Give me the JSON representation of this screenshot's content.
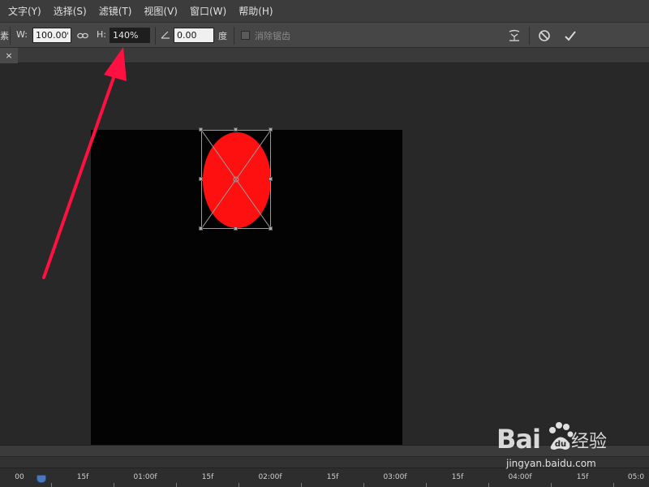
{
  "menu": {
    "items": [
      "文字(Y)",
      "选择(S)",
      "滤镜(T)",
      "视图(V)",
      "窗口(W)",
      "帮助(H)"
    ]
  },
  "options": {
    "left_fragment": "素",
    "width_label": "W:",
    "width_value": "100.00%",
    "link_icon": "chain-link-icon",
    "height_label": "H:",
    "height_value": "140%",
    "angle_icon": "angle-icon",
    "angle_value": "0.00",
    "angle_unit": "度",
    "antialias_label": "消除锯齿",
    "antialias_checked": false,
    "warp_icon": "warp-mode-icon",
    "cancel_icon": "cancel-icon",
    "commit_icon": "commit-checkmark-icon"
  },
  "tab": {
    "close_symbol": "×"
  },
  "artwork": {
    "shape_color": "#ff1010",
    "canvas_color": "#030303",
    "annotation_arrow_color": "#ff1040"
  },
  "timeline": {
    "labels": [
      "00",
      "15f",
      "01:00f",
      "15f",
      "02:00f",
      "15f",
      "03:00f",
      "15f",
      "04:00f",
      "15f",
      "05:0"
    ]
  },
  "watermark": {
    "logo_text": "Bai",
    "logo_suffix": "du",
    "chinese": "经验",
    "url": "jingyan.baidu.com"
  }
}
